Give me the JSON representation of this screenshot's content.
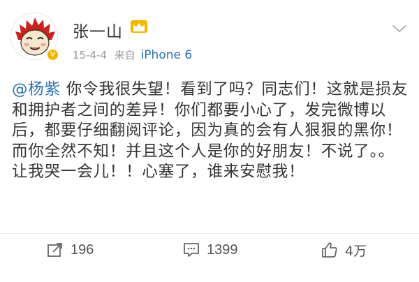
{
  "user": {
    "name": "张一山",
    "verified_badge": "V",
    "crown_icon": "crown-icon",
    "accent": "#f3b700"
  },
  "meta": {
    "date": "15-4-4",
    "source_prefix": "来自",
    "device": "iPhone 6"
  },
  "post": {
    "mention": "@杨紫",
    "text": "你令我很失望！看到了吗？同志们！这就是损友和拥护者之间的差异！你们都要小心了，发完微博以后，都要仔细翻阅评论，因为真的会有人狠狠的黑你！而你全然不知！并且这个人是你的好朋友！不说了。。让我哭一会儿！！心塞了，谁来安慰我！"
  },
  "actions": {
    "repost_count": "196",
    "comment_count": "1399",
    "like_count": "4万"
  },
  "colors": {
    "link": "#2b6fb6",
    "text": "#333333",
    "meta": "#999999"
  }
}
